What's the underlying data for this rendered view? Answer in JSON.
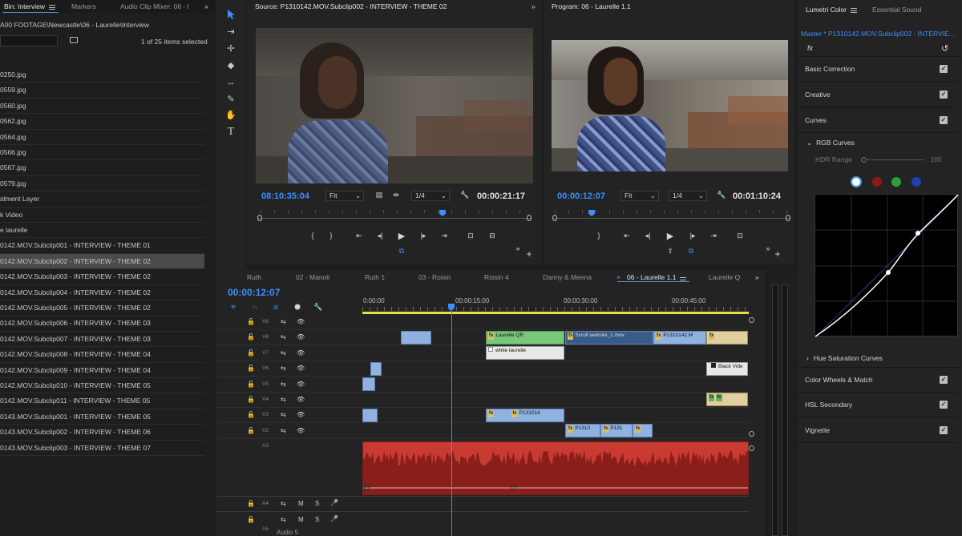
{
  "project": {
    "tabs": [
      {
        "label": "Bin: Interview"
      },
      {
        "label": "Markers"
      },
      {
        "label": "Audio Clip Mixer: 06 - l"
      }
    ],
    "more": "»",
    "path": "A00 FOOTAGE\\Newcastle\\06 - Laurelle\\Interview",
    "count": "1 of 25 items selected",
    "items": [
      "0250.jpg",
      "0559.jpg",
      "0560.jpg",
      "0562.jpg",
      "0564.jpg",
      "0566.jpg",
      "0567.jpg",
      "0579.jpg",
      "stment Layer",
      "k Video",
      "e laurelle",
      "0142.MOV.Subclip001 - INTERVIEW - THEME 01",
      "0142.MOV.Subclip002 - INTERVIEW - THEME 02",
      "0142.MOV.Subclip003 - INTERVIEW - THEME 02",
      "0142.MOV.Subclip004 - INTERVIEW - THEME 02",
      "0142.MOV.Subclip005 - INTERVIEW - THEME 02",
      "0142.MOV.Subclip006 - INTERVIEW - THEME 03",
      "0142.MOV.Subclip007 - INTERVIEW - THEME 03",
      "0142.MOV.Subclip008 - INTERVIEW - THEME 04",
      "0142.MOV.Subclip009 - INTERVIEW - THEME 04",
      "0142.MOV.Subclip010 - INTERVIEW - THEME 05",
      "0142.MOV.Subclip011 - INTERVIEW - THEME 05",
      "0143.MOV.Subclip001 - INTERVIEW - THEME 05",
      "0143.MOV.Subclip002 - INTERVIEW - THEME 06",
      "0143.MOV.Subclip003 - INTERVIEW - THEME 07"
    ]
  },
  "source": {
    "title": "Source: P1310142.MOV.Subclip002 - INTERVIEW - THEME 02",
    "timecode": "08:10:35:04",
    "fit": "Fit",
    "res": "1/4",
    "duration": "00:00:21:17"
  },
  "program": {
    "title": "Program: 06 - Laurelle 1.1",
    "timecode": "00:00:12:07",
    "fit": "Fit",
    "res": "1/4",
    "duration": "00:01:10:24"
  },
  "timeline": {
    "tabs": [
      "Ruth",
      "02 - Manoli",
      "Ruth 1",
      "03 - Roisin",
      "Roisin 4",
      "Danny & Meena",
      "06 - Laurelle 1.1",
      "Laurelle Q"
    ],
    "close": "×",
    "timecode": "00:00:12:07",
    "ruler": [
      "0:00:00",
      "00:00:15:00",
      "00:00:30:00",
      "00:00:45:00"
    ],
    "tracks": [
      "V9",
      "V8",
      "V7",
      "V6",
      "V5",
      "V4",
      "V3",
      "V2"
    ],
    "audio_tracks": [
      "A3",
      "A4",
      "A5"
    ],
    "audio_name": "Audio 5",
    "clips": {
      "laurelle_qr": "Laurelle QR",
      "scroll": "Scroll website_1.mov",
      "p1310142": "P1310142.M",
      "white": "white laurelle",
      "black": "Black Vide",
      "p131014": "P131014",
      "p1310": "P1310",
      "p131": "P131"
    },
    "track_btn": {
      "m": "M",
      "s": "S"
    }
  },
  "lumetri": {
    "tabs": [
      "Lumetri Color",
      "Essential Sound"
    ],
    "master": "Master * P1310142.MOV.Subclip002 - INTERVIE...",
    "sections": [
      "Basic Correction",
      "Creative",
      "Curves"
    ],
    "rgb_curves": "RGB Curves",
    "hdr": "HDR Range",
    "hdr_value": "100",
    "hue_sat": "Hue Saturation Curves",
    "sections2": [
      "Color Wheels & Match",
      "HSL Secondary",
      "Vignette"
    ],
    "channel_colors": [
      "#ffffff",
      "#8b1a1a",
      "#2e9e3a",
      "#1d3fb0"
    ]
  }
}
